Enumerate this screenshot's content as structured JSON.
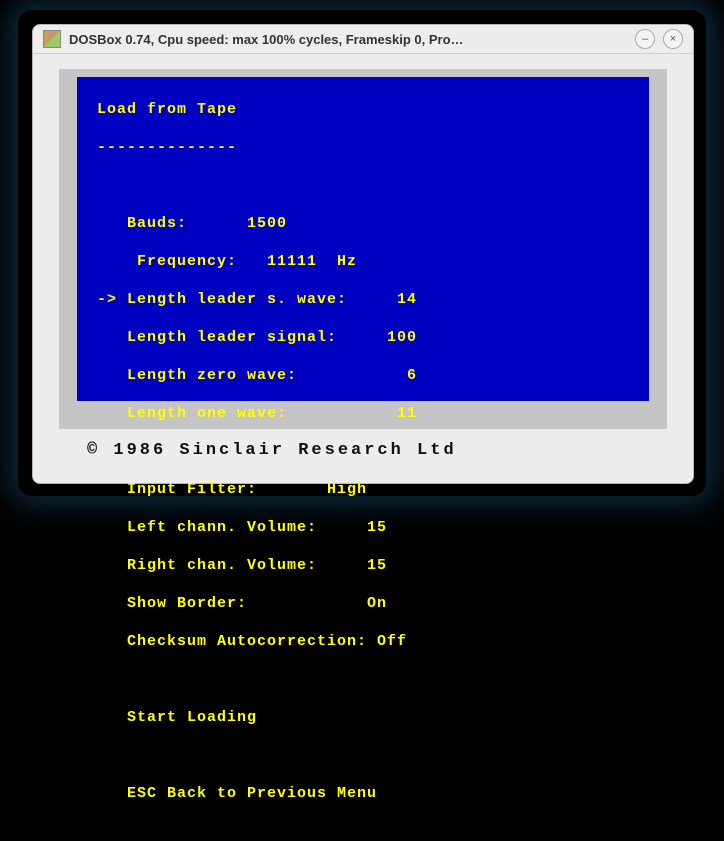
{
  "window": {
    "title": "DOSBox 0.74, Cpu speed: max 100% cycles, Frameskip 0, Pro…"
  },
  "menu": {
    "heading": "  Load from Tape",
    "divider": "  --------------",
    "bauds": "     Bauds:      1500",
    "frequency": "      Frequency:   11111  Hz",
    "len_ls": "  -> Length leader s. wave:     14",
    "len_leader": "     Length leader signal:     100",
    "len_zero": "     Length zero wave:           6",
    "len_one": "     Length one wave:           11",
    "filter": "     Input Filter:       High",
    "left_vol": "     Left chann. Volume:     15",
    "right_vol": "     Right chan. Volume:     15",
    "border": "     Show Border:            On",
    "checksum": "     Checksum Autocorrection: Off",
    "start": "     Start Loading",
    "esc": "     ESC Back to Previous Menu"
  },
  "footer": {
    "copyright": "© 1986 Sinclair Research Ltd"
  }
}
